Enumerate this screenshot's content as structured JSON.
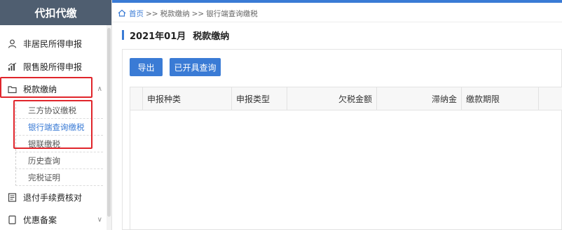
{
  "sidebar": {
    "title": "代扣代缴",
    "items": [
      {
        "label": "非居民所得申报"
      },
      {
        "label": "限售股所得申报"
      },
      {
        "label": "税款缴纳"
      },
      {
        "label": "退付手续费核对"
      },
      {
        "label": "优惠备案"
      }
    ],
    "sub_items": [
      {
        "label": "三方协议缴税"
      },
      {
        "label": "银行端查询缴税"
      },
      {
        "label": "银联缴税"
      },
      {
        "label": "历史查询"
      },
      {
        "label": "完税证明"
      }
    ]
  },
  "breadcrumb": {
    "home": "首页",
    "sep1": ">>",
    "level1": "税款缴纳",
    "sep2": ">>",
    "level2": "银行端查询缴税"
  },
  "page": {
    "period": "2021年01月",
    "title": "税款缴纳"
  },
  "toolbar": {
    "export_label": "导出",
    "query_label": "已开具查询"
  },
  "table": {
    "columns": [
      "申报种类",
      "申报类型",
      "欠税金额",
      "滞纳金",
      "缴款期限"
    ],
    "rows": []
  },
  "colors": {
    "accent": "#3a7bd5",
    "sidebar_header": "#4f5e70",
    "highlight": "#e0252b"
  }
}
